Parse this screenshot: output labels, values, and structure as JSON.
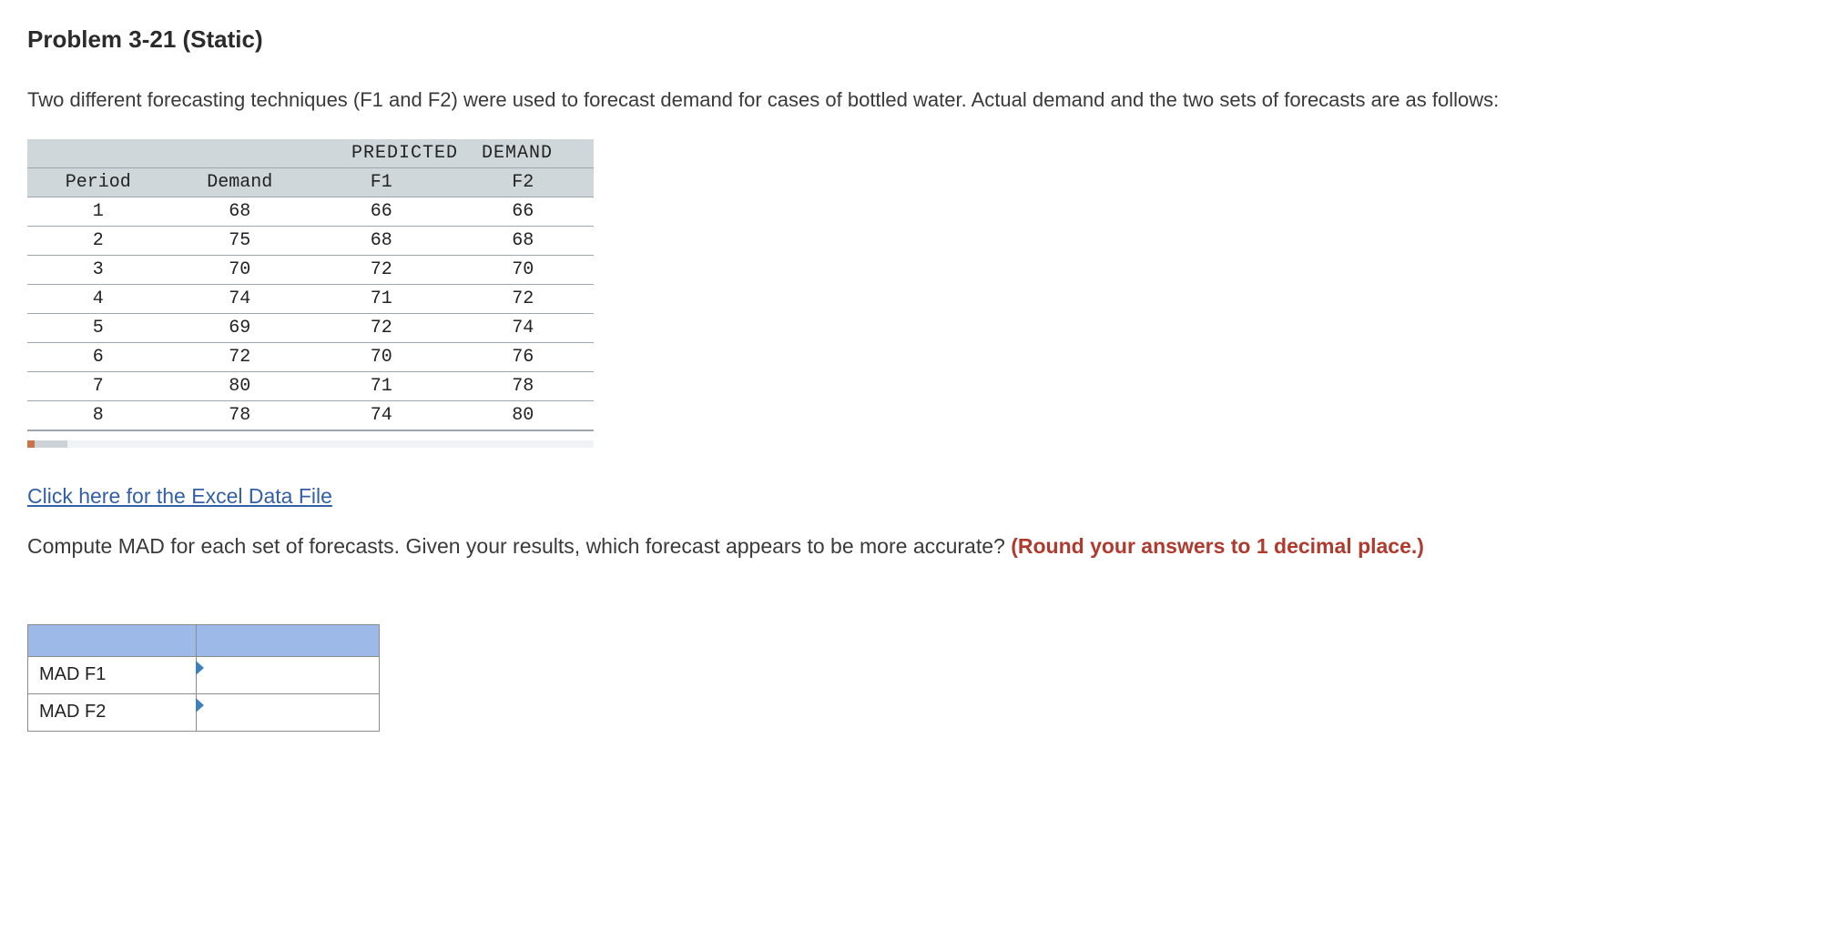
{
  "title": "Problem 3-21 (Static)",
  "intro": "Two different forecasting techniques (F1 and F2) were used to forecast demand for cases of bottled water. Actual demand and the two sets of forecasts are as follows:",
  "table": {
    "span_header": "PREDICTED  DEMAND",
    "columns": {
      "period": "Period",
      "demand": "Demand",
      "f1": "F1",
      "f2": "F2"
    },
    "rows": [
      {
        "period": "1",
        "demand": "68",
        "f1": "66",
        "f2": "66"
      },
      {
        "period": "2",
        "demand": "75",
        "f1": "68",
        "f2": "68"
      },
      {
        "period": "3",
        "demand": "70",
        "f1": "72",
        "f2": "70"
      },
      {
        "period": "4",
        "demand": "74",
        "f1": "71",
        "f2": "72"
      },
      {
        "period": "5",
        "demand": "69",
        "f1": "72",
        "f2": "74"
      },
      {
        "period": "6",
        "demand": "72",
        "f1": "70",
        "f2": "76"
      },
      {
        "period": "7",
        "demand": "80",
        "f1": "71",
        "f2": "78"
      },
      {
        "period": "8",
        "demand": "78",
        "f1": "74",
        "f2": "80"
      }
    ]
  },
  "file_link": "Click here for the Excel Data File",
  "question_lead": "Compute MAD for each set of forecasts. Given your results, which forecast appears to be more accurate? ",
  "question_hint": "(Round your answers to 1 decimal place.)",
  "answer": {
    "row1_label": "MAD F1",
    "row2_label": "MAD F2",
    "row1_value": "",
    "row2_value": ""
  }
}
